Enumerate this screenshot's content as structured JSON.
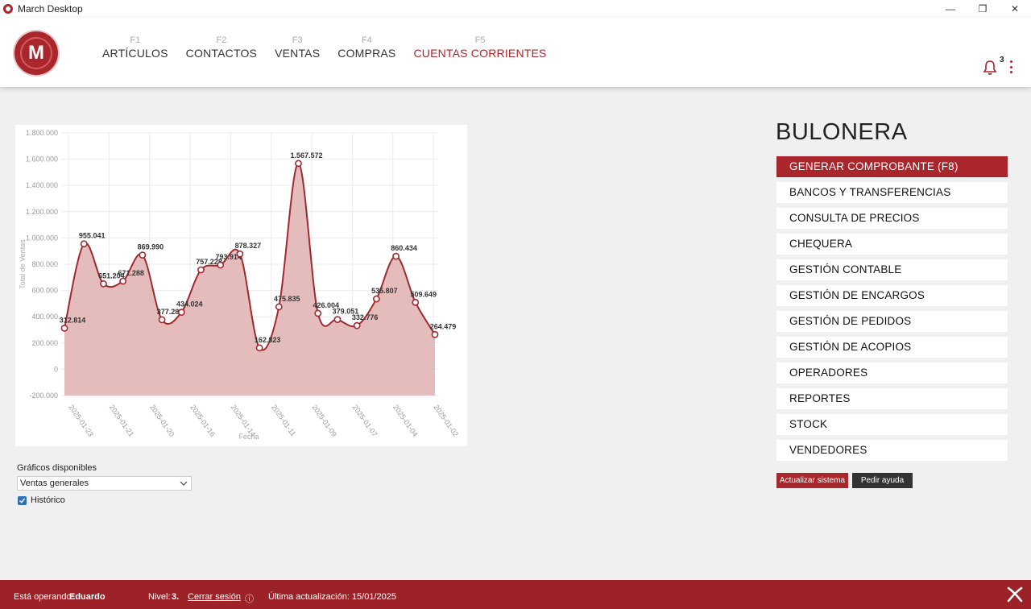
{
  "window": {
    "title": "March Desktop",
    "controls": [
      "—",
      "❐",
      "✕"
    ]
  },
  "nav": [
    {
      "fkey": "F1",
      "label": "ARTÍCULOS"
    },
    {
      "fkey": "F2",
      "label": "CONTACTOS"
    },
    {
      "fkey": "F3",
      "label": "VENTAS"
    },
    {
      "fkey": "F4",
      "label": "COMPRAS"
    },
    {
      "fkey": "F5",
      "label": "CUENTAS CORRIENTES"
    }
  ],
  "logo_letter": "M",
  "notifications": {
    "count": "3"
  },
  "brand": "BULONERA",
  "menu": [
    "GENERAR COMPROBANTE (F8)",
    "BANCOS Y TRANSFERENCIAS",
    "CONSULTA DE PRECIOS",
    "CHEQUERA",
    "GESTIÓN CONTABLE",
    "GESTIÓN DE ENCARGOS",
    "GESTIÓN DE PEDIDOS",
    "GESTIÓN DE ACOPIOS",
    "OPERADORES",
    "REPORTES",
    "STOCK",
    "VENDEDORES"
  ],
  "buttons": {
    "update": "Actualizar sistema",
    "help": "Pedir ayuda"
  },
  "graficos": {
    "label": "Gráficos disponibles",
    "selected": "Ventas generales",
    "historico_label": "Histórico",
    "historico_checked": true
  },
  "status": {
    "operando_label": "Está operando:",
    "user": "Eduardo",
    "nivel_label": "Nivel:",
    "nivel": "3.",
    "logout": "Cerrar sesión",
    "info_icon": "ⓘ",
    "last_update": "Última actualización: 15/01/2025"
  },
  "colors": {
    "brand": "#a8262c",
    "area_fill": "#e0b0b0",
    "line": "#9e2a2f"
  },
  "chart_data": {
    "type": "area",
    "xlabel": "Fecha",
    "ylabel": "Total de Ventas",
    "ylim": [
      -200000,
      1800000
    ],
    "yticks": [
      "-200.000",
      "0",
      "200.000",
      "400.000",
      "600.000",
      "800.000",
      "1.000.000",
      "1.200.000",
      "1.400.000",
      "1.600.000",
      "1.800.000"
    ],
    "xtick_labels": [
      "2025-01-23",
      "2025-01-21",
      "2025-01-20",
      "2025-01-16",
      "2025-01-14",
      "2025-01-11",
      "2025-01-09",
      "2025-01-07",
      "2025-01-04",
      "2025-01-02"
    ],
    "values": [
      312814,
      955041,
      651204,
      671288,
      869990,
      377280,
      434024,
      757228,
      793914,
      878327,
      162823,
      475835,
      1567572,
      426004,
      379051,
      332776,
      535807,
      860434,
      509649,
      264479
    ],
    "value_labels": [
      "312.814",
      "955.041",
      "651.204",
      "671.288",
      "869.990",
      "377.280",
      "434.024",
      "757.228",
      "793.914",
      "878.327",
      "162.823",
      "475.835",
      "1.567.572",
      "426.004",
      "379.051",
      "332.776",
      "535.807",
      "860.434",
      "509.649",
      "264.479"
    ]
  }
}
